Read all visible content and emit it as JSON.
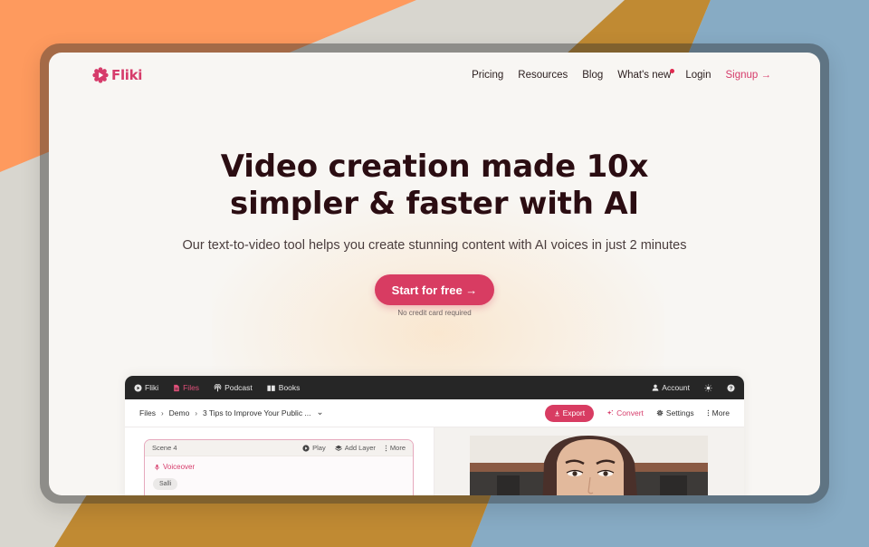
{
  "background": {
    "colors": {
      "orange": "#fe9a5e",
      "gray": "#d8d6cf",
      "gold": "#c08a33",
      "blue": "#87abc4"
    }
  },
  "brand": {
    "name": "Fliki",
    "accent": "#d63c6b"
  },
  "nav": {
    "items": [
      {
        "label": "Pricing"
      },
      {
        "label": "Resources"
      },
      {
        "label": "Blog"
      },
      {
        "label": "What's new",
        "has_dot": true
      },
      {
        "label": "Login"
      }
    ],
    "signup_label": "Signup →"
  },
  "hero": {
    "headline_line1": "Video creation made 10x",
    "headline_line2": "simpler & faster with AI",
    "subheadline": "Our text-to-video tool helps you create stunning content with AI voices in just 2 minutes",
    "cta_label": "Start for free →",
    "cta_note": "No credit card required"
  },
  "app": {
    "topbar": {
      "tabs": [
        {
          "label": "Fliki",
          "icon": "play-circle-icon"
        },
        {
          "label": "Files",
          "icon": "file-icon",
          "active": true
        },
        {
          "label": "Podcast",
          "icon": "podcast-icon"
        },
        {
          "label": "Books",
          "icon": "book-icon"
        }
      ],
      "account_label": "Account",
      "theme_icon": "sun-icon",
      "help_icon": "help-icon"
    },
    "toolbar": {
      "breadcrumbs": [
        "Files",
        "Demo",
        "3 Tips to Improve Your Public ..."
      ],
      "export_label": "Export",
      "convert_label": "Convert",
      "settings_label": "Settings",
      "more_label": "More"
    },
    "scene": {
      "title": "Scene 4",
      "play_label": "Play",
      "add_layer_label": "Add Layer",
      "more_label": "More",
      "voiceover_label": "Voiceover",
      "voice_name": "Salli"
    }
  }
}
